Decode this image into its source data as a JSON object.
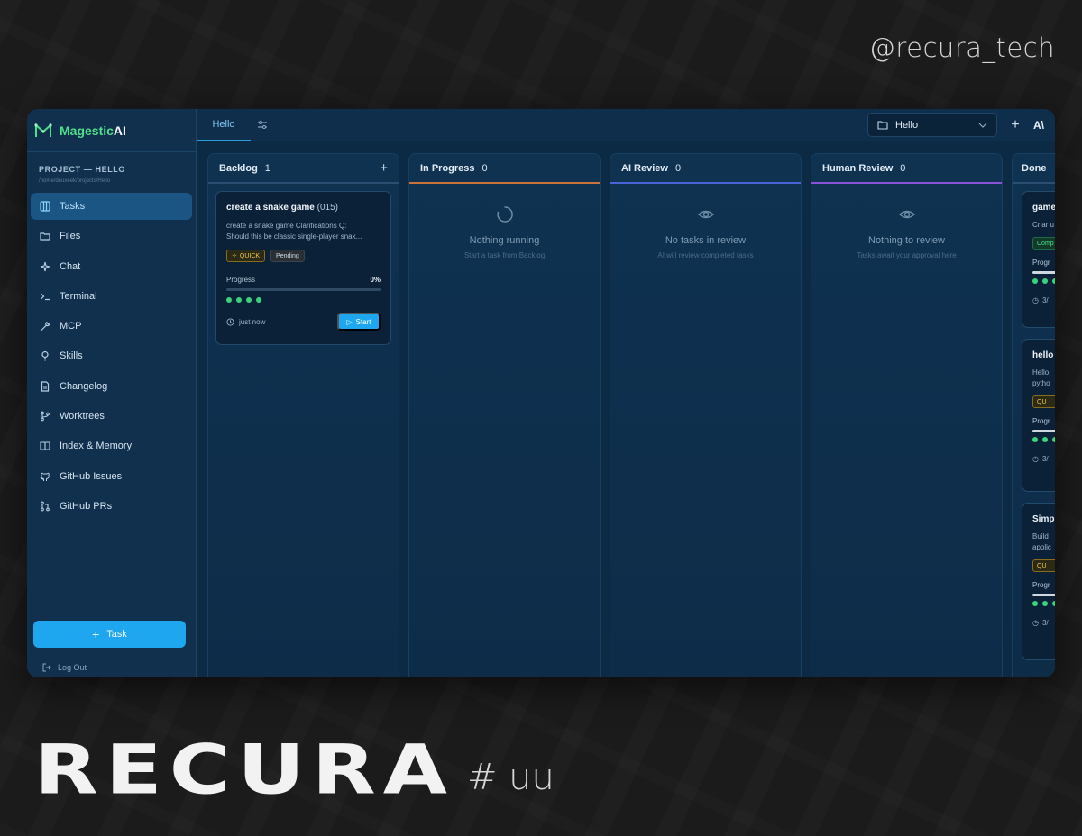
{
  "watermark": {
    "handle": "@recura_tech",
    "brand": "RECURA",
    "tag": "# uu"
  },
  "app": {
    "logo": {
      "name_green": "Magestic",
      "name_white": "AI"
    },
    "project": {
      "title": "PROJECT — HELLO",
      "path": "/home/deuxeek/projects/Hello"
    },
    "nav": [
      {
        "label": "Tasks",
        "icon": "kanban-icon",
        "active": true
      },
      {
        "label": "Files",
        "icon": "folder-icon"
      },
      {
        "label": "Chat",
        "icon": "sparkles-icon"
      },
      {
        "label": "Terminal",
        "icon": "terminal-icon"
      },
      {
        "label": "MCP",
        "icon": "wrench-icon"
      },
      {
        "label": "Skills",
        "icon": "lightbulb-icon"
      },
      {
        "label": "Changelog",
        "icon": "document-icon"
      },
      {
        "label": "Worktrees",
        "icon": "git-branch-icon"
      },
      {
        "label": "Index & Memory",
        "icon": "book-icon"
      },
      {
        "label": "GitHub Issues",
        "icon": "github-icon"
      },
      {
        "label": "GitHub PRs",
        "icon": "git-pull-request-icon"
      }
    ],
    "add_task_label": "Task",
    "logout_label": "Log Out",
    "topbar": {
      "tab_label": "Hello",
      "project_select": "Hello",
      "ai_label": "A\\"
    }
  },
  "board": {
    "backlog": {
      "title": "Backlog",
      "count": "1",
      "card": {
        "title": "create a snake game",
        "number": "(015)",
        "desc_line1": "create a snake game Clarifications Q:",
        "desc_line2": "Should this be classic single-player snak...",
        "badge_quick": "QUICK",
        "badge_status": "Pending",
        "progress_label": "Progress",
        "progress_pct": "0%",
        "progress_value": 0,
        "time": "just now",
        "start_label": "Start"
      }
    },
    "in_progress": {
      "title": "In Progress",
      "count": "0",
      "empty_title": "Nothing running",
      "empty_sub": "Start a task from Backlog",
      "accent": "#c9733b"
    },
    "ai_review": {
      "title": "AI Review",
      "count": "0",
      "empty_title": "No tasks in review",
      "empty_sub": "AI will review completed tasks",
      "accent": "#4b63d8"
    },
    "human_review": {
      "title": "Human Review",
      "count": "0",
      "empty_title": "Nothing to review",
      "empty_sub": "Tasks await your approval here",
      "accent": "#8a50d8"
    },
    "done": {
      "title": "Done",
      "cards": [
        {
          "title": "game",
          "text1": "Criar u",
          "badge": "Comp",
          "prog": "Progr",
          "time": "3/"
        },
        {
          "title": "hello",
          "text1": "Hello",
          "text2": "pytho",
          "badge": "QU",
          "prog": "Progr",
          "time": "3/"
        },
        {
          "title": "Simp",
          "text1": "Build",
          "text2": "applic",
          "badge": "QU",
          "prog": "Progr",
          "time": "3/"
        }
      ]
    }
  },
  "colors": {
    "accent": "#1ea7ee",
    "brand_green": "#4ee08a",
    "bg": "#0d2a45"
  }
}
